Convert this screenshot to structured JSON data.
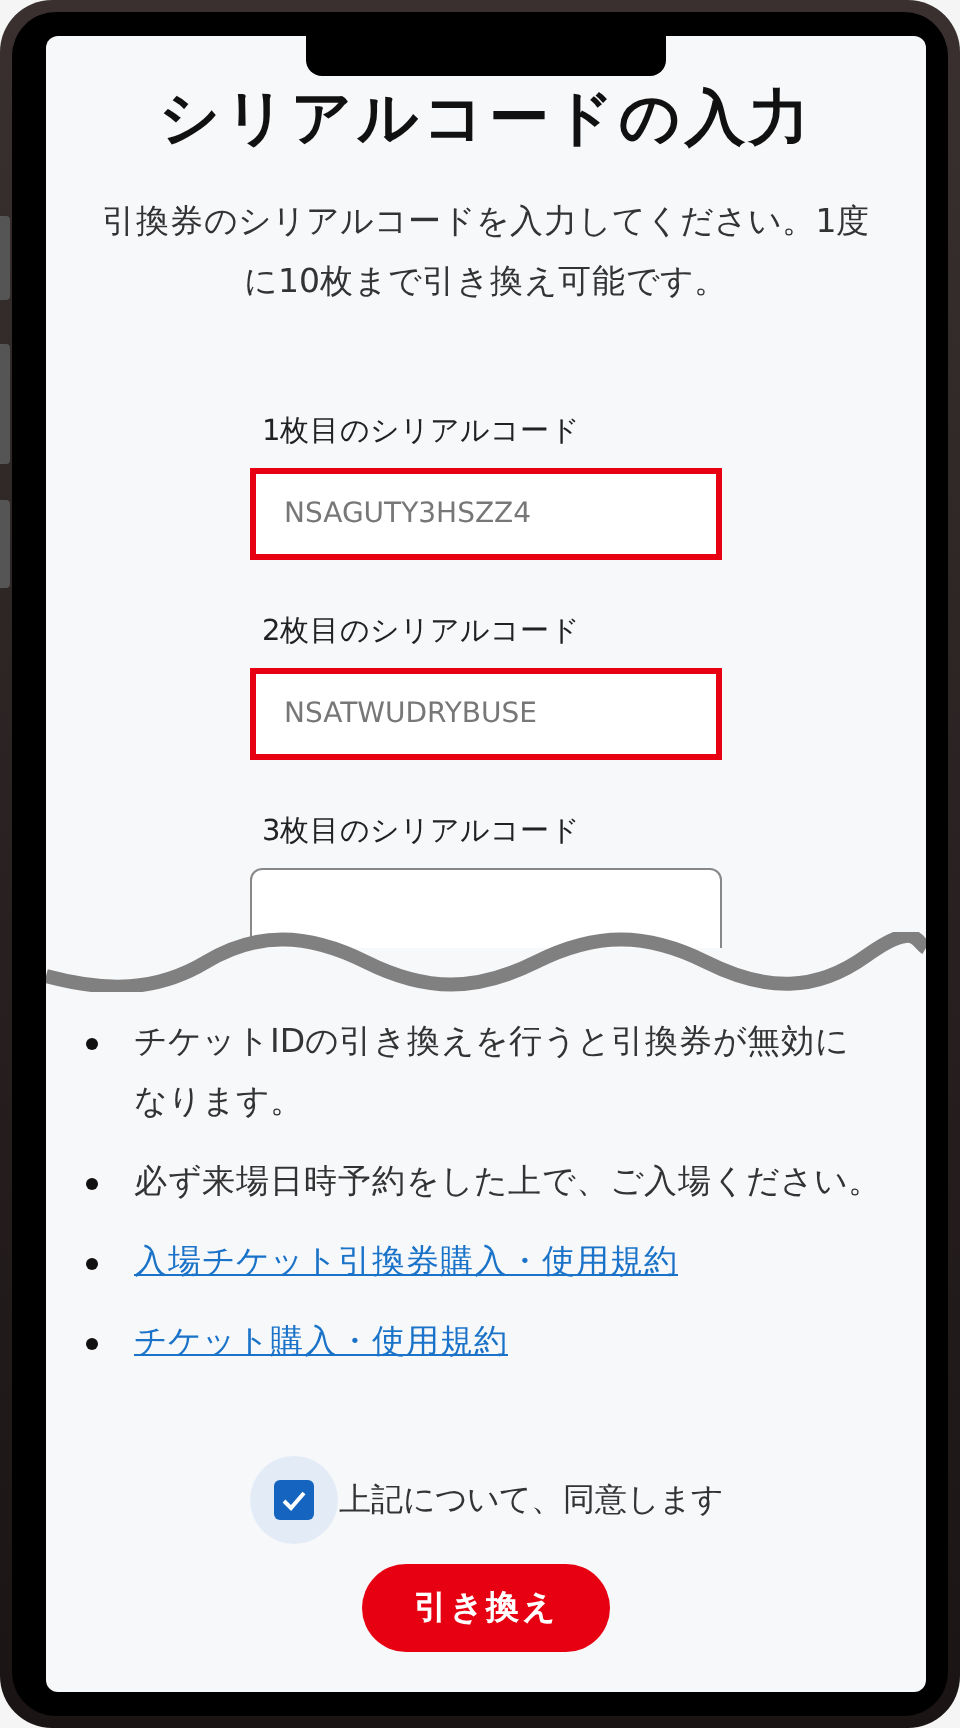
{
  "title": "シリアルコードの入力",
  "description": "引換券のシリアルコードを入力してください。1度に10枚まで引き換え可能です。",
  "serial_fields": [
    {
      "label": "1枚目のシリアルコード",
      "value": "NSAGUTY3HSZZ4",
      "highlighted": true
    },
    {
      "label": "2枚目のシリアルコード",
      "value": "NSATWUDRYBUSE",
      "highlighted": true
    },
    {
      "label": "3枚目のシリアルコード",
      "highlighted": false
    }
  ],
  "notes": [
    {
      "kind": "text",
      "text": "チケットIDの引き換えを行うと引換券が無効になります。"
    },
    {
      "kind": "text",
      "text": "必ず来場日時予約をした上で、ご入場ください。"
    },
    {
      "kind": "link",
      "text": "入場チケット引換券購入・使用規約"
    },
    {
      "kind": "link",
      "text": "チケット購入・使用規約"
    }
  ],
  "agreement": {
    "label": "上記について、同意します",
    "checked": true
  },
  "submit_button": "引き換え"
}
